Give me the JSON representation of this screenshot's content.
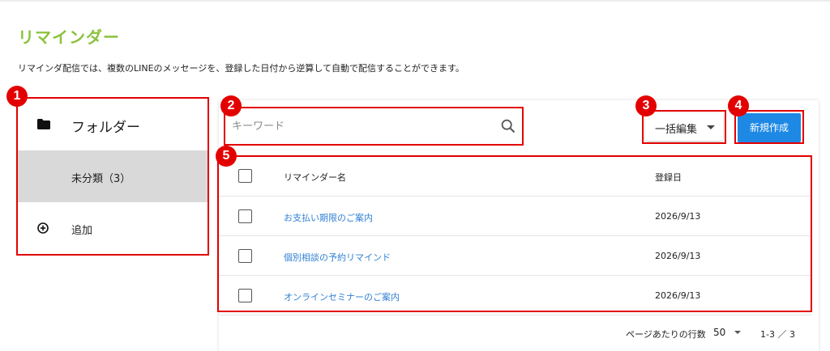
{
  "page": {
    "title": "リマインダー",
    "description": "リマインダ配信では、複数のLINEのメッセージを、登録した日付から逆算して自動で配信することができます。"
  },
  "folders": {
    "header_label": "フォルダー",
    "header_icon": "folder-icon",
    "items": [
      {
        "label": "未分類（3）",
        "selected": true
      }
    ],
    "add_label": "追加",
    "add_icon": "add-circle-icon"
  },
  "toolbar": {
    "search_placeholder": "キーワード",
    "search_value": "",
    "search_icon": "search-icon",
    "bulk_edit_label": "一括編集",
    "new_button_label": "新規作成",
    "new_button_color": "#1e88e5"
  },
  "table": {
    "columns": [
      "リマインダー名",
      "登録日"
    ],
    "rows": [
      {
        "name": "お支払い期限のご案内",
        "date": "2026/9/13"
      },
      {
        "name": "個別相談の予約リマインド",
        "date": "2026/9/13"
      },
      {
        "name": "オンラインセミナーのご案内",
        "date": "2026/9/13"
      }
    ]
  },
  "pagination": {
    "rows_per_page_label": "ページあたりの行数",
    "rows_per_page_value": "50",
    "range_label": "1-3 ／ 3"
  },
  "annotations": [
    "1",
    "2",
    "3",
    "4",
    "5"
  ],
  "colors": {
    "title_green": "#8cc23f",
    "annotation_red": "#e30000",
    "link_blue": "#2f7fd3",
    "selected_gray": "#d9d9d9"
  }
}
